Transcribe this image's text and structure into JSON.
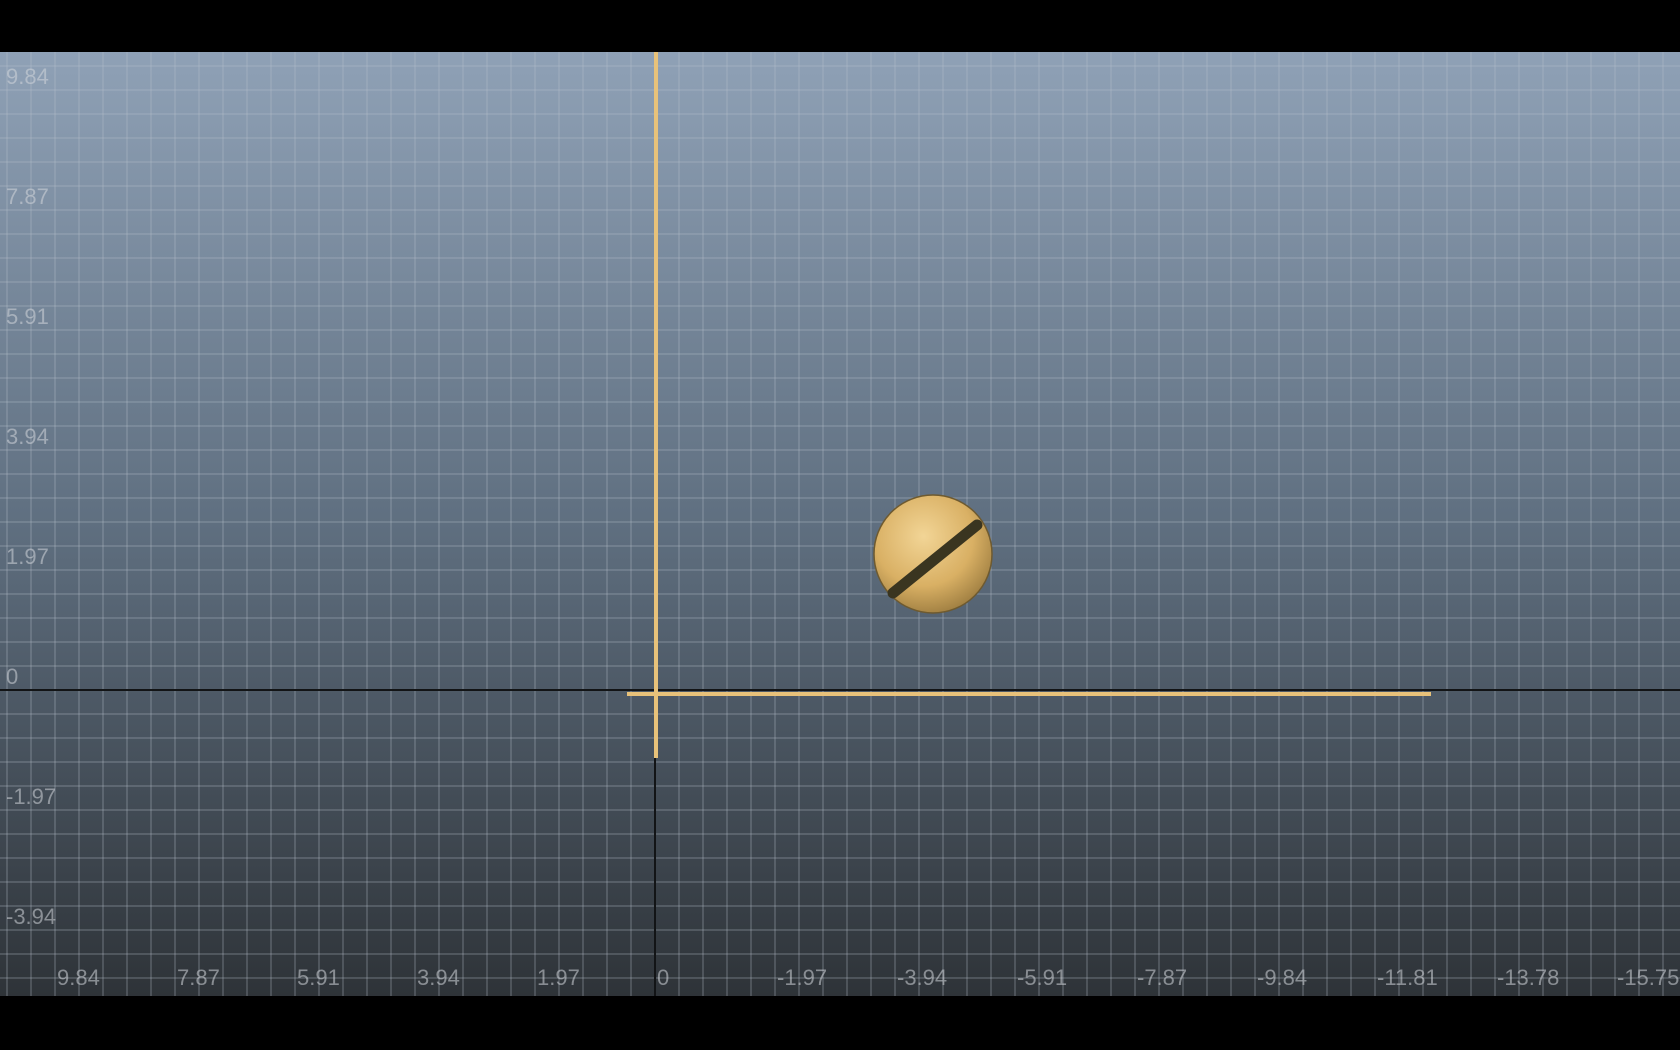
{
  "viewport": {
    "name": "graph-editor-viewport",
    "colors": {
      "background_top": "#8fa1b6",
      "background_mid": "#5f6f80",
      "background_bottom": "#2e3338",
      "grid_line": "#b8c2cc",
      "zero_axis": "#121416",
      "highlight": "#e8c27a",
      "ball_fill": "#d9b064",
      "ball_stripe": "#3a3520"
    },
    "y_axis_labels": [
      "9.84",
      "7.87",
      "5.91",
      "3.94",
      "1.97",
      "0",
      "-1.97",
      "-3.94"
    ],
    "x_axis_labels": [
      "9.84",
      "7.87",
      "5.91",
      "3.94",
      "1.97",
      "0",
      "-1.97",
      "-3.94",
      "-5.91",
      "-7.87",
      "-9.84",
      "-11.81",
      "-13.78",
      "-15.75"
    ],
    "object": {
      "name": "ball",
      "icon": "sphere-with-stripe"
    }
  }
}
